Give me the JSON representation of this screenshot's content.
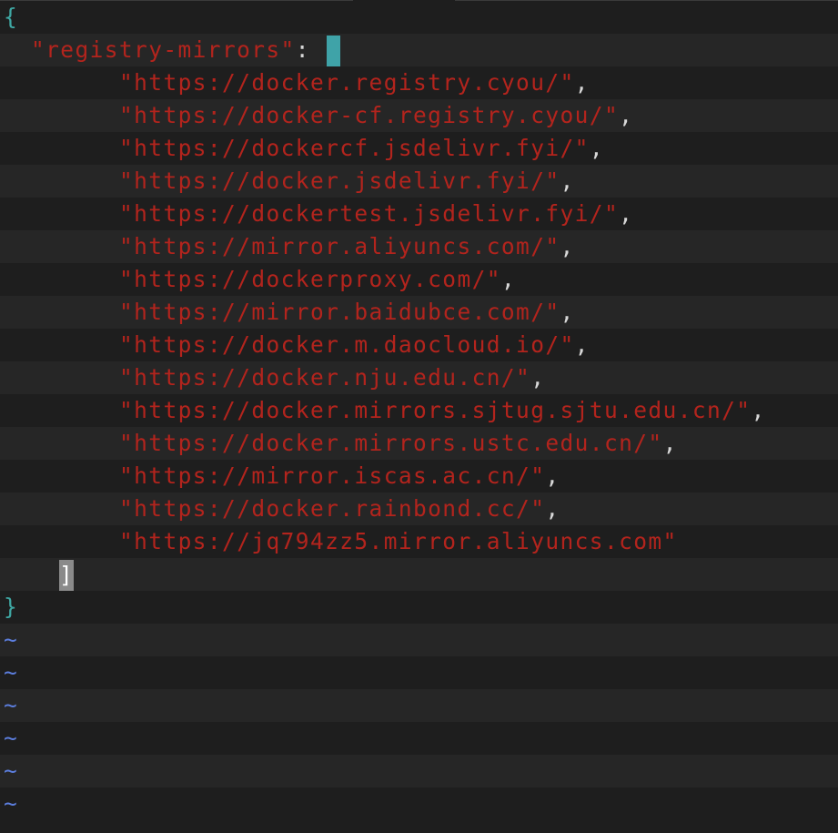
{
  "editor": {
    "open_brace": "{",
    "close_brace": "}",
    "key": "\"registry-mirrors\"",
    "colon": ":",
    "close_bracket": "]",
    "comma": ",",
    "mirrors": [
      "\"https://docker.registry.cyou/\"",
      "\"https://docker-cf.registry.cyou/\"",
      "\"https://dockercf.jsdelivr.fyi/\"",
      "\"https://docker.jsdelivr.fyi/\"",
      "\"https://dockertest.jsdelivr.fyi/\"",
      "\"https://mirror.aliyuncs.com/\"",
      "\"https://dockerproxy.com/\"",
      "\"https://mirror.baidubce.com/\"",
      "\"https://docker.m.daocloud.io/\"",
      "\"https://docker.nju.edu.cn/\"",
      "\"https://docker.mirrors.sjtug.sjtu.edu.cn/\"",
      "\"https://docker.mirrors.ustc.edu.cn/\"",
      "\"https://mirror.iscas.ac.cn/\"",
      "\"https://docker.rainbond.cc/\"",
      "\"https://jq794zz5.mirror.aliyuncs.com\""
    ],
    "empty_line_marker": "~",
    "colors": {
      "background": "#1e1e1e",
      "brace": "#3fa8a4",
      "string": "#b3241d",
      "cursor": "#3fa3a8",
      "tilde": "#5c7ede"
    }
  }
}
